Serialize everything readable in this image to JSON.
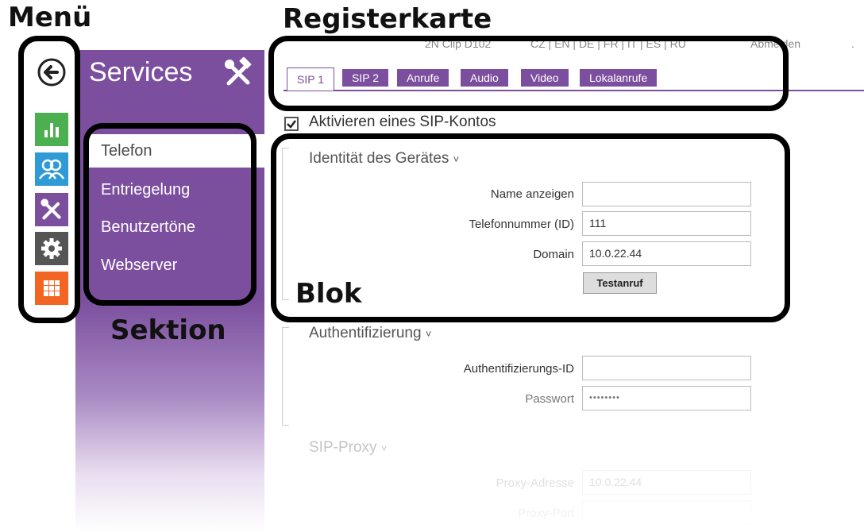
{
  "annotations": {
    "menu": "Menü",
    "tab": "Registerkarte",
    "section": "Sektion",
    "block": "Blok"
  },
  "header": {
    "device": "2N Clip D102",
    "languages": "CZ | EN | DE | FR | IT | ES | RU",
    "logout": "Abmelden",
    "dot": "."
  },
  "sidebar": {
    "title": "Services",
    "items": [
      {
        "label": "Telefon"
      },
      {
        "label": "Entriegelung"
      },
      {
        "label": "Benutzertöne"
      },
      {
        "label": "Webserver"
      }
    ]
  },
  "menu_icons": [
    "back-arrow-icon",
    "status-chart-icon",
    "directory-users-icon",
    "services-tools-icon",
    "settings-gear-icon",
    "system-grid-icon"
  ],
  "colors": {
    "accent": "#7b4f9e",
    "green": "#4caf50",
    "blue": "#2e9bd6",
    "gray": "#555555",
    "orange": "#f26522"
  },
  "tabs": [
    {
      "label": "SIP 1",
      "active": true
    },
    {
      "label": "SIP 2"
    },
    {
      "label": "Anrufe"
    },
    {
      "label": "Audio"
    },
    {
      "label": "Video"
    },
    {
      "label": "Lokalanrufe"
    }
  ],
  "checkbox": {
    "label": "Aktivieren eines SIP-Kontos",
    "checked": true
  },
  "identity": {
    "title": "Identität des Gerätes",
    "name_label": "Name anzeigen",
    "name_value": "",
    "phone_label": "Telefonnummer (ID)",
    "phone_value": "111",
    "domain_label": "Domain",
    "domain_value": "10.0.22.44",
    "test_button": "Testanruf"
  },
  "auth": {
    "title": "Authentifizierung",
    "id_label": "Authentifizierungs-ID",
    "id_value": "",
    "password_label": "Passwort",
    "password_value": "••••••••"
  },
  "proxy": {
    "title": "SIP-Proxy",
    "address_label": "Proxy-Adresse",
    "address_value": "10.0.22.44",
    "port_label": "Proxy-Port"
  }
}
